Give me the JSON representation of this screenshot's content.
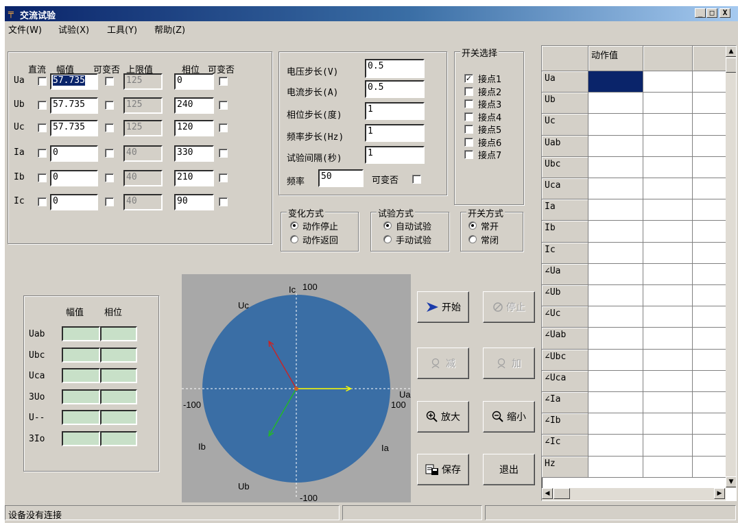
{
  "window": {
    "title": "交流试验",
    "minimize": "_",
    "maximize": "□",
    "close": "X"
  },
  "menu": [
    "文件(W)",
    "试验(X)",
    "工具(Y)",
    "帮助(Z)"
  ],
  "params": {
    "headers": {
      "dc": "直流",
      "amp": "幅值",
      "var1": "可变否",
      "upper": "上限值",
      "phase": "相位",
      "var2": "可变否"
    },
    "rows": [
      {
        "name": "Ua",
        "amp": "57.735",
        "upper": "125",
        "phase": "0"
      },
      {
        "name": "Ub",
        "amp": "57.735",
        "upper": "125",
        "phase": "240"
      },
      {
        "name": "Uc",
        "amp": "57.735",
        "upper": "125",
        "phase": "120"
      },
      {
        "name": "Ia",
        "amp": "0",
        "upper": "40",
        "phase": "330"
      },
      {
        "name": "Ib",
        "amp": "0",
        "upper": "40",
        "phase": "210"
      },
      {
        "name": "Ic",
        "amp": "0",
        "upper": "40",
        "phase": "90"
      }
    ]
  },
  "steps": {
    "voltage_label": "电压步长(V)",
    "voltage_value": "0.5",
    "current_label": "电流步长(A)",
    "current_value": "0.5",
    "phase_label": "相位步长(度)",
    "phase_value": "1",
    "freq_label": "频率步长(Hz)",
    "freq_value": "1",
    "interval_label": "试验间隔(秒)",
    "interval_value": "1",
    "frequency_label": "频率",
    "frequency_value": "50",
    "variable_label": "可变否"
  },
  "switch_select": {
    "title": "开关选择",
    "contacts": [
      {
        "label": "接点1",
        "checked": true
      },
      {
        "label": "接点2",
        "checked": false
      },
      {
        "label": "接点3",
        "checked": false
      },
      {
        "label": "接点4",
        "checked": false
      },
      {
        "label": "接点5",
        "checked": false
      },
      {
        "label": "接点6",
        "checked": false
      },
      {
        "label": "接点7",
        "checked": false
      }
    ]
  },
  "change_mode": {
    "title": "变化方式",
    "opt1": "动作停止",
    "opt2": "动作返回",
    "selected": 0
  },
  "test_mode": {
    "title": "试验方式",
    "opt1": "自动试验",
    "opt2": "手动试验",
    "selected": 0
  },
  "switch_mode": {
    "title": "开关方式",
    "opt1": "常开",
    "opt2": "常闭",
    "selected": 0
  },
  "measure": {
    "header_amp": "幅值",
    "header_phase": "相位",
    "rows": [
      "Uab",
      "Ubc",
      "Uca",
      "3Uo",
      "U--",
      "3Io"
    ]
  },
  "phasor": {
    "labels": {
      "top": "100",
      "ic": "Ic",
      "uc": "Uc",
      "ua": "Ua",
      "right": "100",
      "left": "-100",
      "ib": "Ib",
      "ia": "Ia",
      "ub": "Ub",
      "bottom": "-100"
    },
    "vectors": [
      {
        "name": "Ua",
        "angle": 0,
        "magnitude": 57.735,
        "color": "#ffff00"
      },
      {
        "name": "Ub",
        "angle": 240,
        "magnitude": 57.735,
        "color": "#22bb22"
      },
      {
        "name": "Uc",
        "angle": 120,
        "magnitude": 57.735,
        "color": "#cc2222"
      }
    ],
    "colors": {
      "disk": "#3a6ea5",
      "bg": "#a8a8a8",
      "axis": "#ffffff"
    }
  },
  "buttons": {
    "start": "开始",
    "stop": "停止",
    "decrease": "减",
    "increase": "加",
    "zoom_in": "放大",
    "zoom_out": "缩小",
    "save": "保存",
    "exit": "退出"
  },
  "grid": {
    "column_header": "动作值",
    "rows": [
      "Ua",
      "Ub",
      "Uc",
      "Uab",
      "Ubc",
      "Uca",
      "Ia",
      "Ib",
      "Ic",
      "∠Ua",
      "∠Ub",
      "∠Uc",
      "∠Uab",
      "∠Ubc",
      "∠Uca",
      "∠Ia",
      "∠Ib",
      "∠Ic",
      "Hz"
    ]
  },
  "status": {
    "text": "设备没有连接"
  }
}
